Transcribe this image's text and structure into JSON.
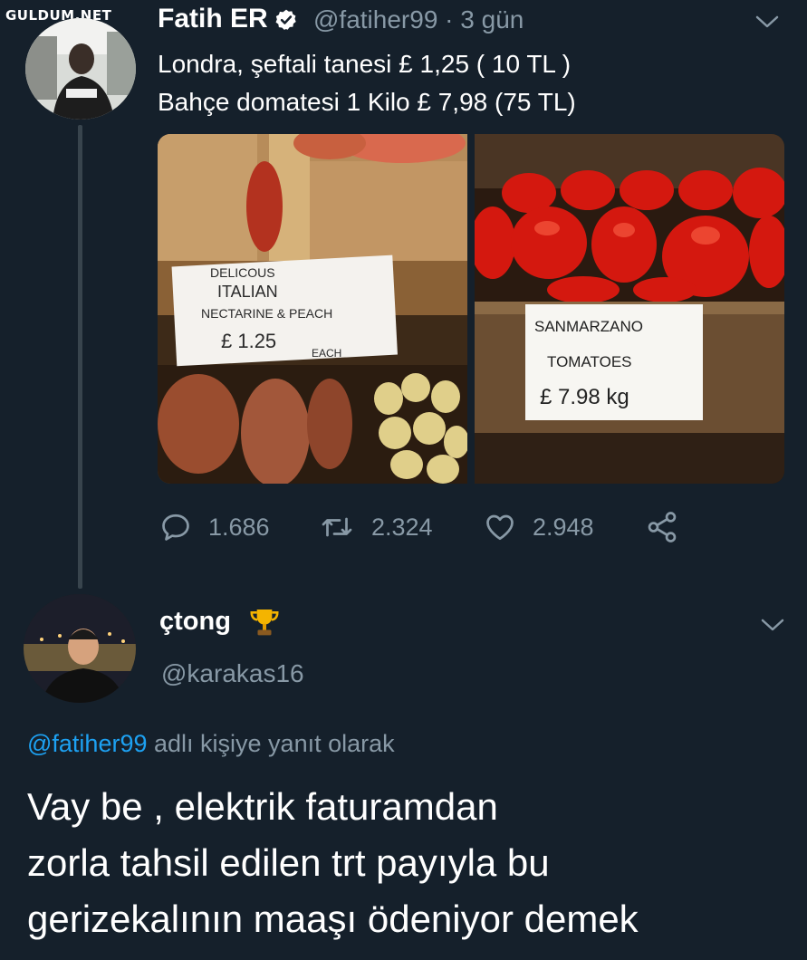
{
  "watermark": "GULDUM.NET",
  "tweet": {
    "author_name": "Fatih ER",
    "author_handle": "@fatiher99",
    "separator": "·",
    "time": "3 gün",
    "lines": [
      "Londra, şeftali tanesi £ 1,25 ( 10 TL )",
      "Bahçe domatesi 1 Kilo £ 7,98 (75 TL)"
    ],
    "photo_left_sign": [
      "DELICOUS",
      "ITALIAN",
      "NECTARINE & PEACH",
      "£ 1.25",
      "EACH"
    ],
    "photo_right_sign": [
      "SANMARZANO",
      "TOMATOES",
      "£ 7.98 kg"
    ],
    "stats": {
      "replies": "1.686",
      "retweets": "2.324",
      "likes": "2.948"
    }
  },
  "reply": {
    "author_name": "çtong",
    "author_handle": "@karakas16",
    "reply_to_mention": "@fatiher99",
    "reply_to_suffix": "adlı kişiye yanıt olarak",
    "lines": [
      "Vay be , elektrik faturamdan",
      "zorla tahsil edilen trt payıyla bu",
      "gerizekalının maaşı ödeniyor demek"
    ]
  },
  "colors": {
    "background": "#15202b",
    "secondary_text": "#8899a6",
    "link": "#1da1f2",
    "verified": "#ffffff",
    "trophy": "#f4b400"
  }
}
